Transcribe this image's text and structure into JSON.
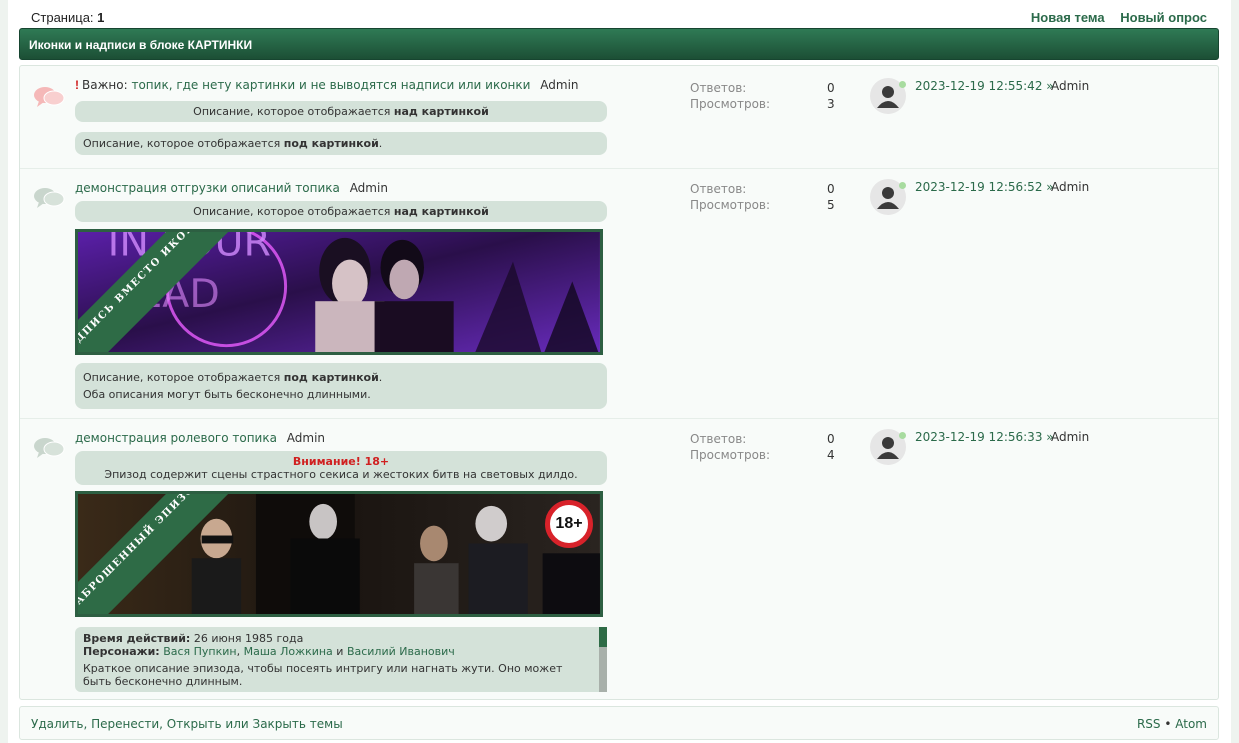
{
  "topline": {
    "pages_label": "Страница:",
    "pages_current": "1",
    "new_topic": "Новая тема",
    "new_poll": "Новый опрос"
  },
  "forum_title": "Иконки и надписи в блоке КАРТИНКИ",
  "stats_labels": {
    "replies": "Ответов:",
    "views": "Просмотров:"
  },
  "topics": [
    {
      "important_mark": "!",
      "important_label": "Важно:",
      "title": "топик, где нету картинки и не выводятся надписи или иконки",
      "author": "Admin",
      "desc_above": {
        "text": "Описание, которое отображается ",
        "bold": "над картинкой"
      },
      "desc_below": {
        "text": "Описание, которое отображается ",
        "bold": "под картинкой",
        "tail": "."
      },
      "replies": "0",
      "views": "3",
      "last_time": "2023-12-19 12:55:42 »",
      "last_author": "Admin"
    },
    {
      "title": "демонстрация отгрузки описаний топика",
      "author": "Admin",
      "desc_above": {
        "text": "Описание, которое отображается ",
        "bold": "над картинкой"
      },
      "ribbon": "НАДПИСЬ ВМЕСТО ИКОНКИ",
      "desc_below": {
        "text": "Описание, которое отображается ",
        "bold": "под картинкой",
        "tail": "."
      },
      "desc_below_2": "Оба описания могут быть бесконечно длинными.",
      "replies": "0",
      "views": "5",
      "last_time": "2023-12-19 12:56:52 »",
      "last_author": "Admin"
    },
    {
      "title": "демонстрация ролевого топика",
      "author": "Admin",
      "warning_title": "Внимание! 18+",
      "warning_text": "Эпизод содержит сцены страстного секиса и жестоких битв на световых дилдо.",
      "ribbon": "ЗАБРОШЕННЫЙ ЭПИЗОД",
      "age_badge": "18+",
      "time_label": "Время действий:",
      "time_value": "26 июня 1985 года",
      "chars_label": "Персонажи:",
      "char_1": "Вася Пупкин",
      "char_2": "Маша Ложкина",
      "char_and": "и",
      "char_3": "Василий Иванович",
      "summary": "Краткое описание эпизода, чтобы посеять интригу или нагнать жути. Оно может быть бесконечно длинным.",
      "replies": "0",
      "views": "4",
      "last_time": "2023-12-19 12:56:33 »",
      "last_author": "Admin"
    }
  ],
  "footer": {
    "mod_links": "Удалить, Перенести, Открыть или Закрыть темы",
    "rss": "RSS",
    "sep": "•",
    "atom": "Atom"
  },
  "colors": {
    "accent": "#2b6a4a",
    "bar": "#1f5a3c",
    "pill": "#d4e2d9",
    "warning": "#d02020"
  }
}
